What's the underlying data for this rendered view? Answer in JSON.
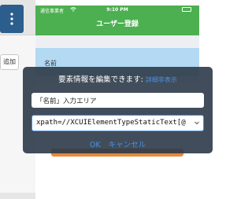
{
  "editor": {
    "add_button_label": "追加"
  },
  "phone": {
    "status_bar": {
      "carrier": "通信事業者",
      "time": "9:10 PM"
    },
    "nav_title": "ユーザー登録",
    "field_label": "名前",
    "colors": {
      "nav_green": "#4caf50",
      "highlight_blue": "#b3d9f3",
      "button_orange": "#e5893a"
    }
  },
  "popup": {
    "title": "要素情報を編集できます:",
    "link_label": "詳細非表示",
    "name_value": "「名前」入力エリア",
    "xpath_value": "xpath=//XCUIElementTypeStaticText[@",
    "ok_label": "OK",
    "cancel_label": "キャンセル"
  },
  "icons": {
    "menu": "kebab-menu-icon",
    "wifi": "wifi-icon",
    "battery": "battery-icon",
    "dropdown": "chevron-down-icon"
  }
}
